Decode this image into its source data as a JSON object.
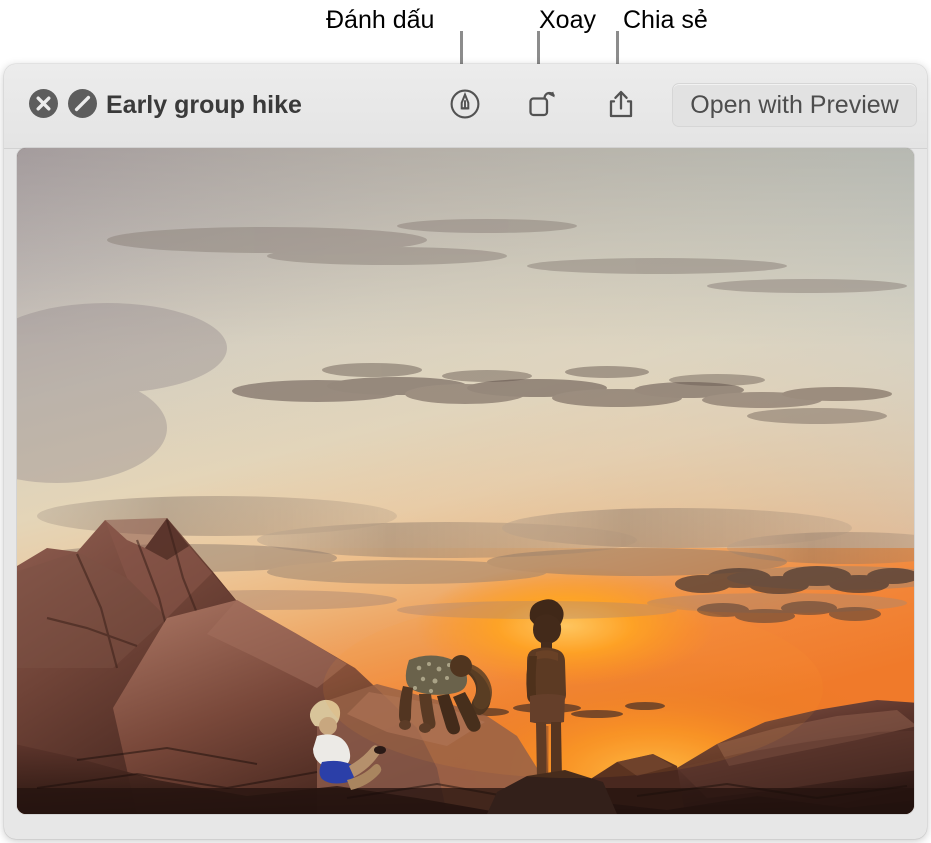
{
  "callouts": [
    {
      "id": "markup",
      "label": "Đánh dấu"
    },
    {
      "id": "rotate",
      "label": "Xoay"
    },
    {
      "id": "share",
      "label": "Chia sẻ"
    }
  ],
  "window": {
    "title": "Early group hike",
    "toolbar": {
      "close_icon": "close-circle-icon",
      "disable_icon": "slash-circle-icon",
      "markup_icon": "markup-pen-icon",
      "rotate_icon": "rotate-left-icon",
      "share_icon": "share-up-arrow-icon",
      "open_with_label": "Open with Preview"
    },
    "photo": {
      "alt": "Three hikers silhouetted on red sandstone rocks at sunset",
      "colors": {
        "sky_top_left": "#b9aeb0",
        "sky_top_right": "#cfcdc4",
        "sky_mid": "#e8d8bb",
        "sky_glow": "#f5a742",
        "sky_hot": "#f8820f",
        "horizon_band": "#e07a4a",
        "rock_light": "#9d6a5c",
        "rock_mid": "#6d4238",
        "rock_dark": "#3a211c",
        "rock_deep": "#241410",
        "cloud_shadow": "#8d8076",
        "shirt_white": "#f2f0ee",
        "shorts_blue": "#2b3fa8",
        "silhouette": "#32201c"
      }
    }
  }
}
